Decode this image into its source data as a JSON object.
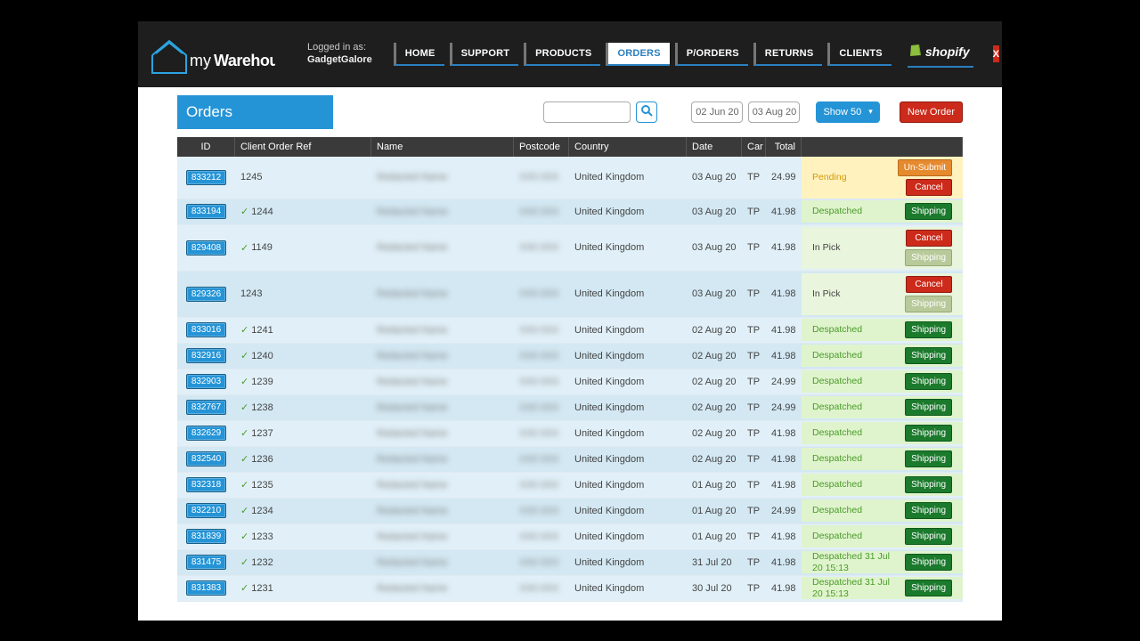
{
  "header": {
    "logged_in_label": "Logged in as:",
    "username": "GadgetGalore",
    "nav": [
      "HOME",
      "SUPPORT",
      "PRODUCTS",
      "ORDERS",
      "P/ORDERS",
      "RETURNS",
      "CLIENTS"
    ],
    "active_nav": "ORDERS",
    "shopify_label": "shopify",
    "close_label": "X"
  },
  "toolbar": {
    "title": "Orders",
    "date_from": "02 Jun 20",
    "date_to": "03 Aug 20",
    "show_label": "Show 50",
    "new_order_label": "New Order"
  },
  "columns": {
    "id": "ID",
    "ref": "Client Order Ref",
    "name": "Name",
    "postcode": "Postcode",
    "country": "Country",
    "date": "Date",
    "car": "Car",
    "total": "Total"
  },
  "rows": [
    {
      "id": "833212",
      "ref": "1245",
      "check": false,
      "country": "United Kingdom",
      "date": "03 Aug 20",
      "car": "TP",
      "total": "24.99",
      "status": "Pending",
      "status_style": "pending",
      "actions": [
        {
          "t": "unsubmit",
          "l": "Un-Submit"
        },
        {
          "t": "cancel",
          "l": "Cancel"
        }
      ],
      "tall": true
    },
    {
      "id": "833194",
      "ref": "1244",
      "check": true,
      "country": "United Kingdom",
      "date": "03 Aug 20",
      "car": "TP",
      "total": "41.98",
      "status": "Despatched",
      "status_style": "green",
      "actions": [
        {
          "t": "ship",
          "l": "Shipping"
        }
      ]
    },
    {
      "id": "829408",
      "ref": "1149",
      "check": true,
      "country": "United Kingdom",
      "date": "03 Aug 20",
      "car": "TP",
      "total": "41.98",
      "status": "In Pick",
      "status_style": "pick",
      "actions": [
        {
          "t": "cancel",
          "l": "Cancel"
        },
        {
          "t": "ship-dis",
          "l": "Shipping"
        }
      ],
      "tall": true,
      "inpick": true
    },
    {
      "id": "829326",
      "ref": "1243",
      "check": false,
      "country": "United Kingdom",
      "date": "03 Aug 20",
      "car": "TP",
      "total": "41.98",
      "status": "In Pick",
      "status_style": "pick",
      "actions": [
        {
          "t": "cancel",
          "l": "Cancel"
        },
        {
          "t": "ship-dis",
          "l": "Shipping"
        }
      ],
      "tall": true,
      "inpick": true
    },
    {
      "id": "833016",
      "ref": "1241",
      "check": true,
      "country": "United Kingdom",
      "date": "02 Aug 20",
      "car": "TP",
      "total": "41.98",
      "status": "Despatched",
      "status_style": "green",
      "actions": [
        {
          "t": "ship",
          "l": "Shipping"
        }
      ]
    },
    {
      "id": "832916",
      "ref": "1240",
      "check": true,
      "country": "United Kingdom",
      "date": "02 Aug 20",
      "car": "TP",
      "total": "41.98",
      "status": "Despatched",
      "status_style": "green",
      "actions": [
        {
          "t": "ship",
          "l": "Shipping"
        }
      ]
    },
    {
      "id": "832903",
      "ref": "1239",
      "check": true,
      "country": "United Kingdom",
      "date": "02 Aug 20",
      "car": "TP",
      "total": "24.99",
      "status": "Despatched",
      "status_style": "green",
      "actions": [
        {
          "t": "ship",
          "l": "Shipping"
        }
      ]
    },
    {
      "id": "832767",
      "ref": "1238",
      "check": true,
      "country": "United Kingdom",
      "date": "02 Aug 20",
      "car": "TP",
      "total": "24.99",
      "status": "Despatched",
      "status_style": "green",
      "actions": [
        {
          "t": "ship",
          "l": "Shipping"
        }
      ]
    },
    {
      "id": "832629",
      "ref": "1237",
      "check": true,
      "country": "United Kingdom",
      "date": "02 Aug 20",
      "car": "TP",
      "total": "41.98",
      "status": "Despatched",
      "status_style": "green",
      "actions": [
        {
          "t": "ship",
          "l": "Shipping"
        }
      ]
    },
    {
      "id": "832540",
      "ref": "1236",
      "check": true,
      "country": "United Kingdom",
      "date": "02 Aug 20",
      "car": "TP",
      "total": "41.98",
      "status": "Despatched",
      "status_style": "green",
      "actions": [
        {
          "t": "ship",
          "l": "Shipping"
        }
      ]
    },
    {
      "id": "832318",
      "ref": "1235",
      "check": true,
      "country": "United Kingdom",
      "date": "01 Aug 20",
      "car": "TP",
      "total": "41.98",
      "status": "Despatched",
      "status_style": "green",
      "actions": [
        {
          "t": "ship",
          "l": "Shipping"
        }
      ]
    },
    {
      "id": "832210",
      "ref": "1234",
      "check": true,
      "country": "United Kingdom",
      "date": "01 Aug 20",
      "car": "TP",
      "total": "24.99",
      "status": "Despatched",
      "status_style": "green",
      "actions": [
        {
          "t": "ship",
          "l": "Shipping"
        }
      ]
    },
    {
      "id": "831839",
      "ref": "1233",
      "check": true,
      "country": "United Kingdom",
      "date": "01 Aug 20",
      "car": "TP",
      "total": "41.98",
      "status": "Despatched",
      "status_style": "green",
      "actions": [
        {
          "t": "ship",
          "l": "Shipping"
        }
      ]
    },
    {
      "id": "831475",
      "ref": "1232",
      "check": true,
      "country": "United Kingdom",
      "date": "31 Jul 20",
      "car": "TP",
      "total": "41.98",
      "status": "Despatched 31 Jul 20 15:13",
      "status_style": "green",
      "actions": [
        {
          "t": "ship",
          "l": "Shipping"
        }
      ]
    },
    {
      "id": "831383",
      "ref": "1231",
      "check": true,
      "country": "United Kingdom",
      "date": "30 Jul 20",
      "car": "TP",
      "total": "41.98",
      "status": "Despatched 31 Jul 20 15:13",
      "status_style": "green",
      "actions": [
        {
          "t": "ship",
          "l": "Shipping"
        }
      ]
    }
  ]
}
